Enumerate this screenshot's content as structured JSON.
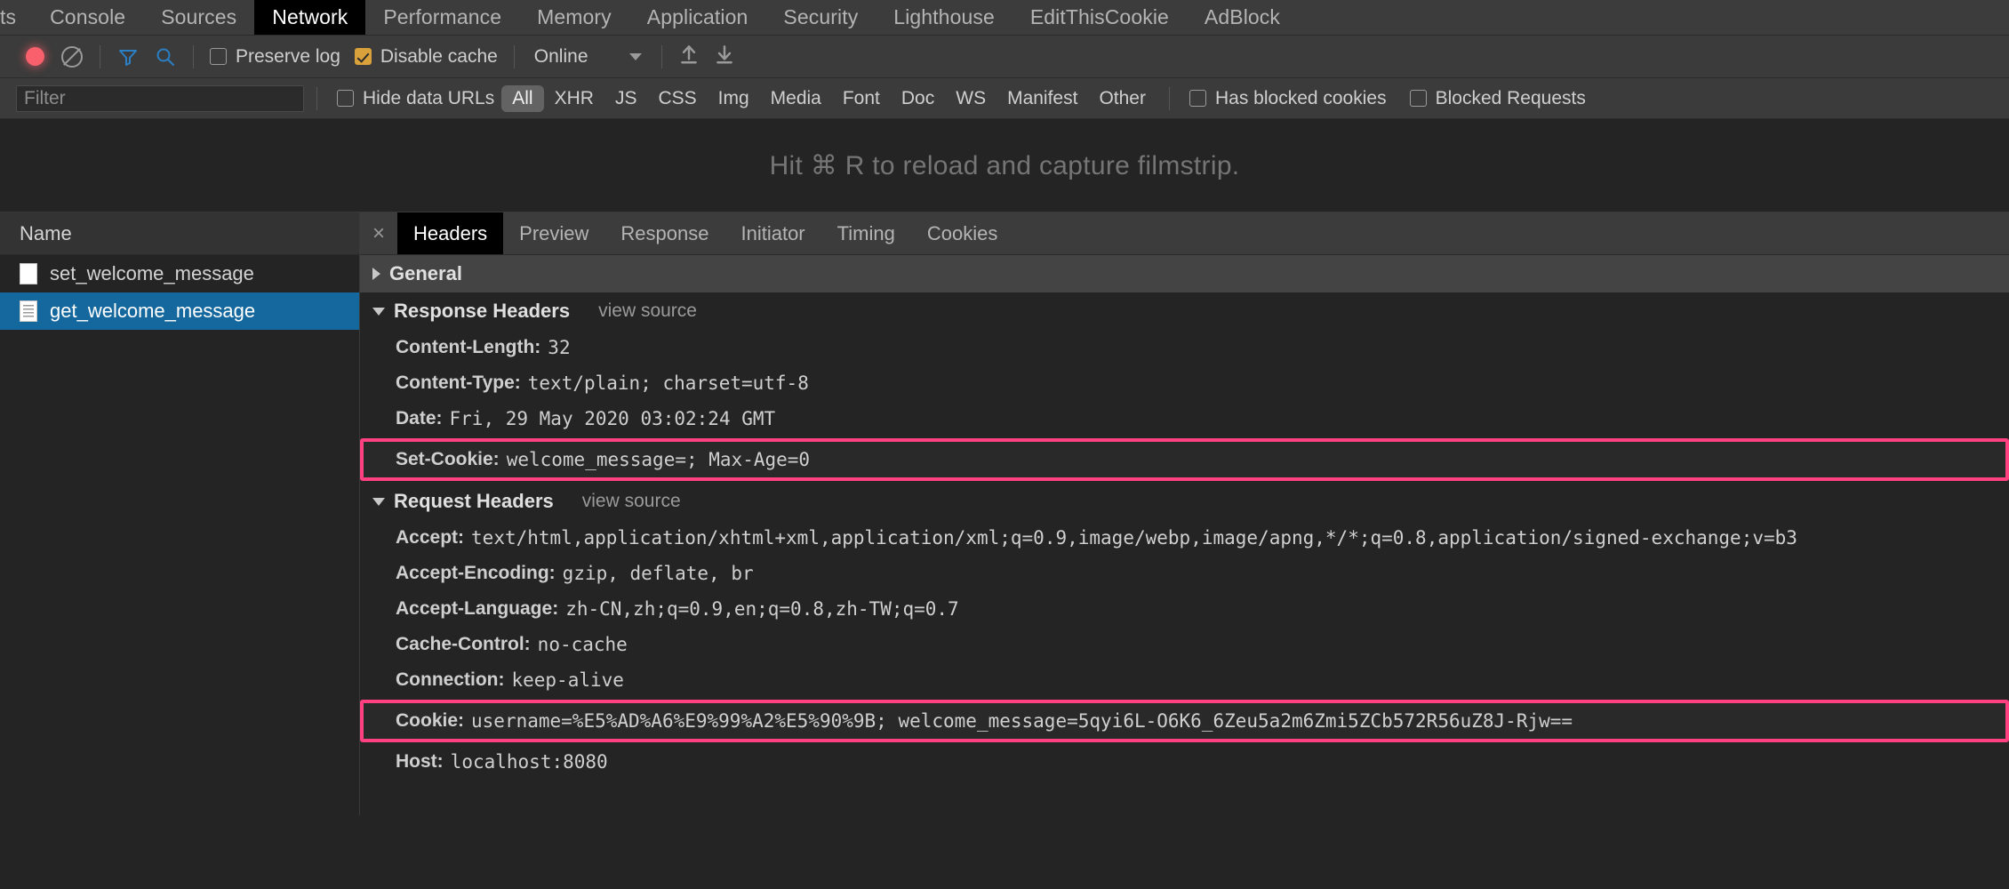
{
  "devtools": {
    "panel_tabs": [
      {
        "label": "ts",
        "active": false,
        "clipped": true
      },
      {
        "label": "Console",
        "active": false
      },
      {
        "label": "Sources",
        "active": false
      },
      {
        "label": "Network",
        "active": true
      },
      {
        "label": "Performance",
        "active": false
      },
      {
        "label": "Memory",
        "active": false
      },
      {
        "label": "Application",
        "active": false
      },
      {
        "label": "Security",
        "active": false
      },
      {
        "label": "Lighthouse",
        "active": false
      },
      {
        "label": "EditThisCookie",
        "active": false
      },
      {
        "label": "AdBlock",
        "active": false
      }
    ],
    "toolbar": {
      "record_title": "record-button",
      "clear_title": "clear-button",
      "filter_title": "filter-toggle",
      "search_title": "search-toggle",
      "preserve_log": {
        "label": "Preserve log",
        "checked": false
      },
      "disable_cache": {
        "label": "Disable cache",
        "checked": true
      },
      "throttle_value": "Online",
      "import_title": "import-har",
      "export_title": "export-har"
    },
    "filterbar": {
      "filter_placeholder": "Filter",
      "filter_value": "",
      "hide_data_urls": {
        "label": "Hide data URLs",
        "checked": false
      },
      "types": [
        {
          "label": "All",
          "selected": true
        },
        {
          "label": "XHR",
          "selected": false
        },
        {
          "label": "JS",
          "selected": false
        },
        {
          "label": "CSS",
          "selected": false
        },
        {
          "label": "Img",
          "selected": false
        },
        {
          "label": "Media",
          "selected": false
        },
        {
          "label": "Font",
          "selected": false
        },
        {
          "label": "Doc",
          "selected": false
        },
        {
          "label": "WS",
          "selected": false
        },
        {
          "label": "Manifest",
          "selected": false
        },
        {
          "label": "Other",
          "selected": false
        }
      ],
      "has_blocked_cookies": {
        "label": "Has blocked cookies",
        "checked": false
      },
      "blocked_requests": {
        "label": "Blocked Requests",
        "checked": false
      }
    },
    "filmstrip": {
      "message": "Hit ⌘ R to reload and capture filmstrip."
    },
    "requests": {
      "column_header": "Name",
      "rows": [
        {
          "name": "set_welcome_message",
          "selected": false,
          "icon": "document-icon"
        },
        {
          "name": "get_welcome_message",
          "selected": true,
          "icon": "document-lines-icon"
        }
      ]
    },
    "details": {
      "close_label": "×",
      "tabs": [
        {
          "label": "Headers",
          "active": true
        },
        {
          "label": "Preview",
          "active": false
        },
        {
          "label": "Response",
          "active": false
        },
        {
          "label": "Initiator",
          "active": false
        },
        {
          "label": "Timing",
          "active": false
        },
        {
          "label": "Cookies",
          "active": false
        }
      ],
      "sections": [
        {
          "title": "General",
          "expanded": false,
          "view_source": "",
          "rows": []
        },
        {
          "title": "Response Headers",
          "expanded": true,
          "view_source": "view source",
          "rows": [
            {
              "name": "Content-Length:",
              "value": "32",
              "highlighted": false
            },
            {
              "name": "Content-Type:",
              "value": "text/plain; charset=utf-8",
              "highlighted": false
            },
            {
              "name": "Date:",
              "value": "Fri, 29 May 2020 03:02:24 GMT",
              "highlighted": false
            },
            {
              "name": "Set-Cookie:",
              "value": "welcome_message=; Max-Age=0",
              "highlighted": true
            }
          ]
        },
        {
          "title": "Request Headers",
          "expanded": true,
          "view_source": "view source",
          "rows": [
            {
              "name": "Accept:",
              "value": "text/html,application/xhtml+xml,application/xml;q=0.9,image/webp,image/apng,*/*;q=0.8,application/signed-exchange;v=b3",
              "highlighted": false
            },
            {
              "name": "Accept-Encoding:",
              "value": "gzip, deflate, br",
              "highlighted": false
            },
            {
              "name": "Accept-Language:",
              "value": "zh-CN,zh;q=0.9,en;q=0.8,zh-TW;q=0.7",
              "highlighted": false
            },
            {
              "name": "Cache-Control:",
              "value": "no-cache",
              "highlighted": false
            },
            {
              "name": "Connection:",
              "value": "keep-alive",
              "highlighted": false
            },
            {
              "name": "Cookie:",
              "value": "username=%E5%AD%A6%E9%99%A2%E5%90%9B; welcome_message=5qyi6L-O6K6_6Zeu5a2m6Zmi5ZCb572R56uZ8J-Rjw==",
              "highlighted": true
            },
            {
              "name": "Host:",
              "value": "localhost:8080",
              "highlighted": false
            }
          ]
        }
      ]
    },
    "colors": {
      "accent_highlight": "#ff4081",
      "selection_blue": "#14689e",
      "checkbox_checked": "#d9a13b",
      "record_red": "#f9606b"
    }
  }
}
